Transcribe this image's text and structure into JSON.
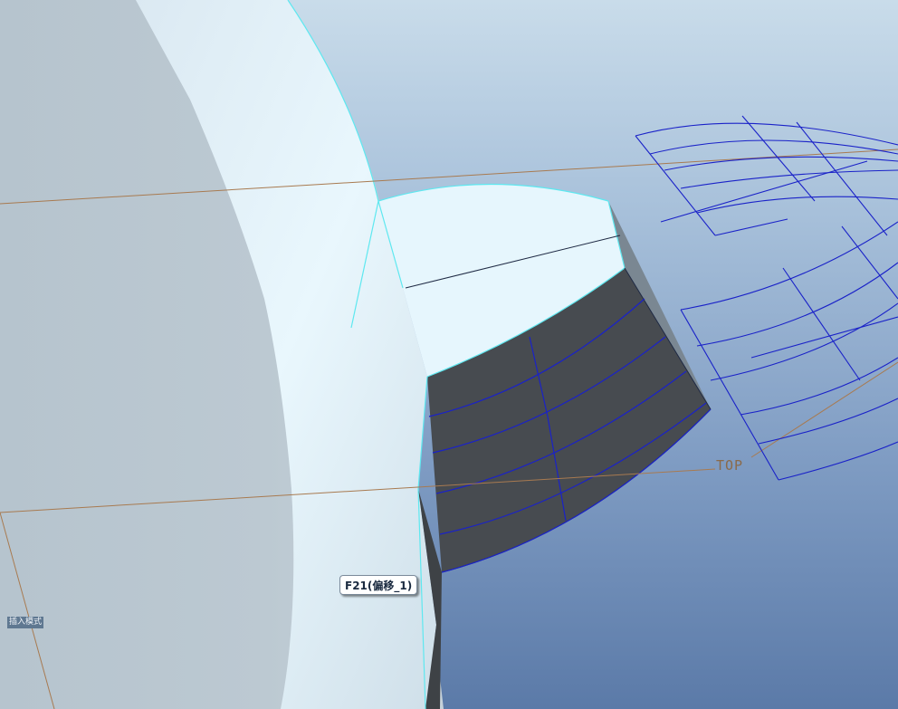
{
  "viewport": {
    "feature_tag": "F21(偏移_1)",
    "mode_badge": "插入模式",
    "datum_plane_label": "TOP"
  },
  "colors": {
    "background_top": "#c9dcea",
    "background_bottom": "#5b7aa8",
    "body_surface": "#b9c7d1",
    "highlight_surface": "#e8f6fc",
    "offset_face": "#474b50",
    "edge_highlight": "#5ee8f0",
    "datum_plane": "#a87a50",
    "curve": "#1a22c8"
  },
  "icons": [
    "datum-plane-icon"
  ]
}
